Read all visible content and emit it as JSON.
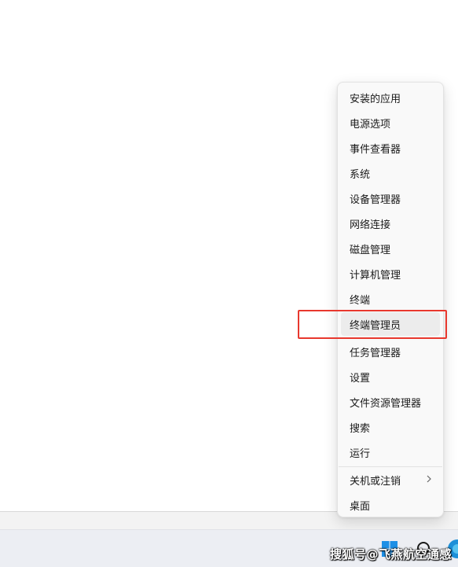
{
  "context_menu": {
    "items": [
      {
        "label": "安装的应用"
      },
      {
        "label": "电源选项"
      },
      {
        "label": "事件查看器"
      },
      {
        "label": "系统"
      },
      {
        "label": "设备管理器"
      },
      {
        "label": "网络连接"
      },
      {
        "label": "磁盘管理"
      },
      {
        "label": "计算机管理"
      },
      {
        "label": "终端"
      },
      {
        "label": "终端管理员"
      },
      {
        "label": "任务管理器"
      },
      {
        "label": "设置"
      },
      {
        "label": "文件资源管理器"
      },
      {
        "label": "搜索"
      },
      {
        "label": "运行"
      },
      {
        "label": "关机或注销"
      },
      {
        "label": "桌面"
      }
    ],
    "highlighted_item": "终端管理员",
    "highlight_color": "#e8382e"
  },
  "taskbar": {
    "icons": [
      "windows-start-icon",
      "search-icon",
      "edge-icon"
    ]
  },
  "watermark": "搜狐号@飞燕航空通感"
}
